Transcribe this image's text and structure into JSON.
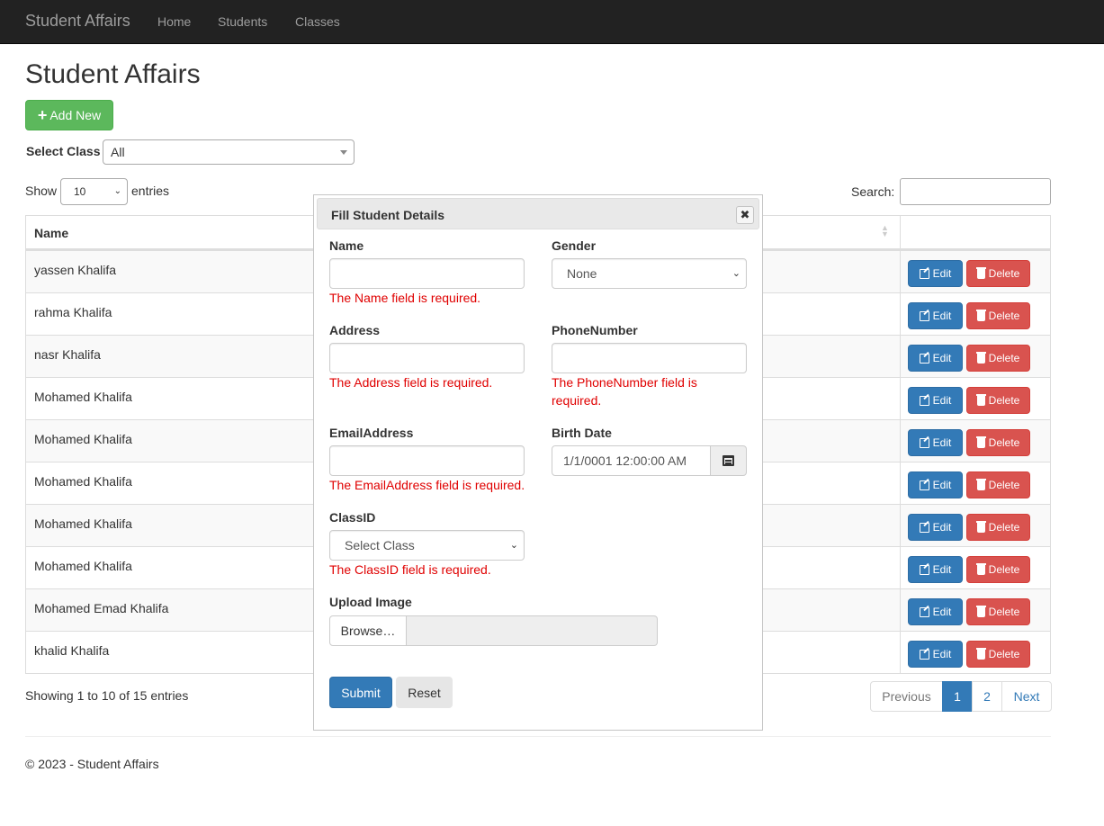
{
  "navbar": {
    "brand": "Student Affairs",
    "links": [
      "Home",
      "Students",
      "Classes"
    ]
  },
  "page": {
    "title": "Student Affairs",
    "add_new_label": "Add New",
    "select_class_label": "Select Class",
    "select_class_value": "All"
  },
  "table_controls": {
    "show_label": "Show",
    "length_value": "10",
    "entries_label": "entries",
    "search_label": "Search:",
    "search_value": ""
  },
  "table": {
    "header_name": "Name",
    "edit_label": "Edit",
    "delete_label": "Delete",
    "rows": [
      "yassen Khalifa",
      "rahma Khalifa",
      "nasr Khalifa",
      "Mohamed Khalifa",
      "Mohamed Khalifa",
      "Mohamed Khalifa",
      "Mohamed Khalifa",
      "Mohamed Khalifa",
      "Mohamed Emad Khalifa",
      "khalid Khalifa"
    ]
  },
  "pagination": {
    "info": "Showing 1 to 10 of 15 entries",
    "previous": "Previous",
    "pages": [
      "1",
      "2"
    ],
    "active_page": "1",
    "next": "Next"
  },
  "footer": {
    "text": "© 2023 - Student Affairs"
  },
  "dialog": {
    "title": "Fill Student Details",
    "close_symbol": "✖",
    "name_label": "Name",
    "name_value": "",
    "name_error": "The Name field is required.",
    "gender_label": "Gender",
    "gender_value": "None",
    "address_label": "Address",
    "address_value": "",
    "address_error": "The Address field is required.",
    "phone_label": "PhoneNumber",
    "phone_value": "",
    "phone_error_line1": "The PhoneNumber field is",
    "phone_error_line2": "required.",
    "email_label": "EmailAddress",
    "email_value": "",
    "email_error": "The EmailAddress field is required.",
    "birth_label": "Birth Date",
    "birth_value": "1/1/0001 12:00:00 AM",
    "class_label": "ClassID",
    "class_value": "Select Class",
    "class_error": "The ClassID field is required.",
    "upload_label": "Upload Image",
    "browse_label": "Browse…",
    "submit_label": "Submit",
    "reset_label": "Reset"
  },
  "colors": {
    "navbar_bg": "#222222",
    "success": "#5cb85c",
    "primary": "#337ab7",
    "danger": "#d9534f",
    "error_text": "#e00000"
  }
}
